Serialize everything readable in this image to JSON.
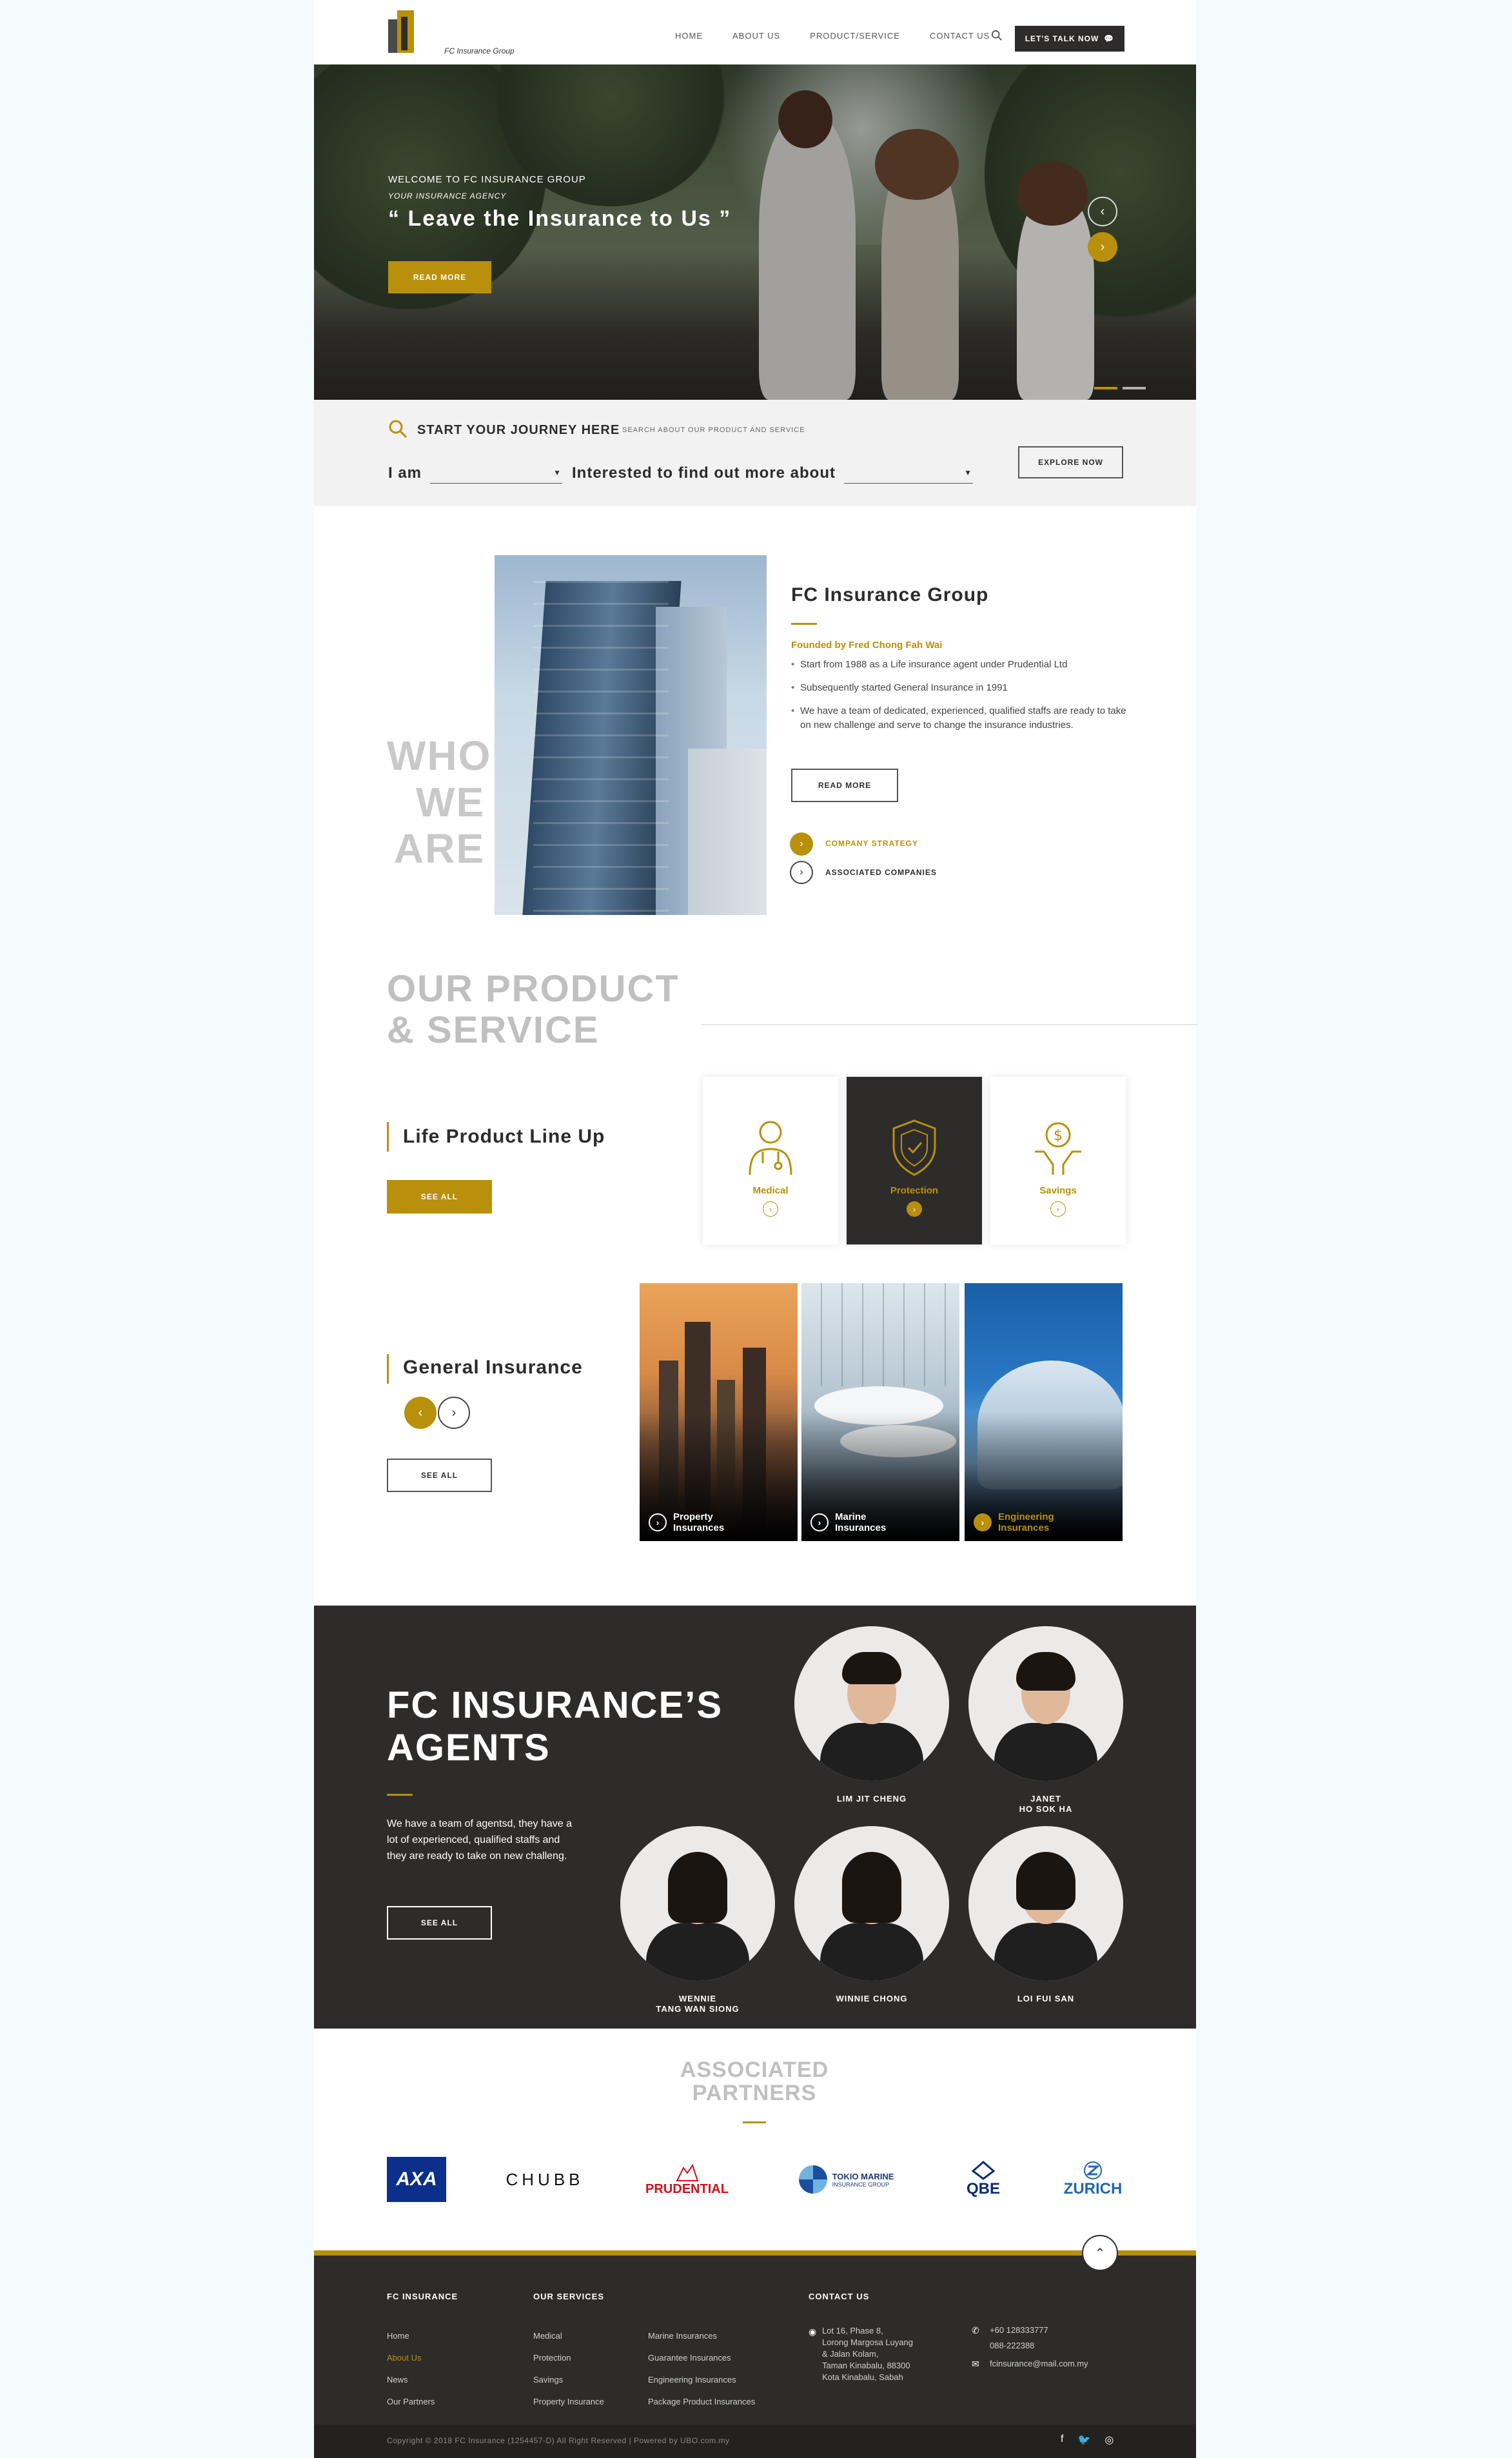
{
  "brand": {
    "logo_text": "FC Insurance Group",
    "accent": "#b8900b",
    "dark": "#2d2c2b"
  },
  "nav": {
    "items": [
      "HOME",
      "ABOUT US",
      "PRODUCT/SERVICE",
      "CONTACT US"
    ],
    "talk_label": "LET'S TALK NOW"
  },
  "hero": {
    "welcome": "WELCOME TO FC INSURANCE GROUP",
    "agency": "YOUR INSURANCE AGENCY",
    "quote": "“ Leave the Insurance to Us ”",
    "button": "READ MORE",
    "arrow_prev": "‹",
    "arrow_next": "›"
  },
  "search": {
    "title": "START YOUR JOURNEY HERE",
    "subtitle": "SEARCH ABOUT OUR PRODUCT AND SERVICE",
    "iam": "I am",
    "interest": "Interested to find out more about",
    "explore": "EXPLORE NOW"
  },
  "who": {
    "title": "WHO WE ARE",
    "heading": "FC Insurance Group",
    "founder": "Founded by Fred Chong Fah Wai",
    "bullets": [
      "Start from 1988 as a Life insurance agent under Prudential Ltd",
      "Subsequently started General Insurance in 1991",
      "We have a team of dedicated, experienced, qualified staffs are ready to take on new challenge and serve to change the insurance industries."
    ],
    "button": "READ MORE",
    "link_strategy": "COMPANY STRATEGY",
    "link_associated": "ASSOCIATED COMPANIES"
  },
  "products": {
    "title_line1": "OUR PRODUCT",
    "title_line2": "& SERVICE",
    "life_heading": "Life Product Line Up",
    "see_all": "SEE ALL",
    "cards": [
      "Medical",
      "Protection",
      "Savings"
    ],
    "general_heading": "General Insurance",
    "tiles": [
      {
        "l1": "Property",
        "l2": "Insurances"
      },
      {
        "l1": "Marine",
        "l2": "Insurances"
      },
      {
        "l1": "Engineering",
        "l2": "Insurances"
      }
    ]
  },
  "agents": {
    "title_line1": "FC INSURANCE’S",
    "title_line2": "AGENTS",
    "text": "We have a team of agentsd, they have a lot of experienced, qualified staffs and they are ready to take on new challeng.",
    "button": "SEE ALL",
    "people": [
      {
        "l1": "LIM JIT CHENG",
        "l2": ""
      },
      {
        "l1": "JANET",
        "l2": "HO SOK HA"
      },
      {
        "l1": "WENNIE",
        "l2": "TANG WAN SIONG"
      },
      {
        "l1": "WINNIE CHONG",
        "l2": ""
      },
      {
        "l1": "LOI FUI SAN",
        "l2": ""
      }
    ]
  },
  "partners": {
    "title_line1": "ASSOCIATED",
    "title_line2": "PARTNERS",
    "logos": [
      "AXA",
      "CHUBB",
      "PRUDENTIAL",
      "TOKIO MARINE",
      "QBE",
      "ZURICH"
    ],
    "tokio_sub": "INSURANCE GROUP"
  },
  "footer": {
    "col1_head": "FC INSURANCE",
    "col1": [
      "Home",
      "About Us",
      "News",
      "Our Partners"
    ],
    "col2_head": "OUR SERVICES",
    "col2a": [
      "Medical",
      "Protection",
      "Savings",
      "Property Insurance"
    ],
    "col2b": [
      "Marine Insurances",
      "Guarantee Insurances",
      "Engineering Insurances",
      "Package Product Insurances"
    ],
    "col3_head": "CONTACT US",
    "address": [
      "Lot 16, Phase 8,",
      "Lorong Margosa Luyang",
      "& Jalan Kolam,",
      "Taman Kinabalu, 88300",
      "Kota Kinabalu, Sabah"
    ],
    "phone1": "+60 128333777",
    "phone2": "088-222388",
    "email": "fcinsurance@mail.com.my",
    "copyright": "Copyright © 2018 FC Insurance (1254457-D) All Right Reserved   |   Powered by UBO.com.my",
    "to_top": "⌃"
  }
}
